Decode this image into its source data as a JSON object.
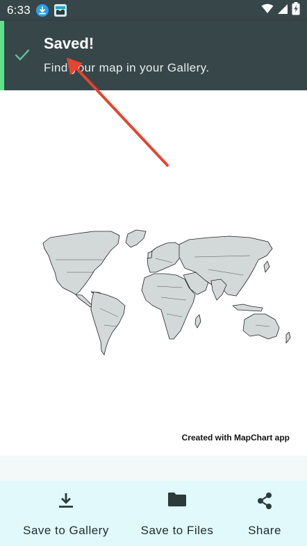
{
  "status_bar": {
    "time": "6:33"
  },
  "toast": {
    "title": "Saved!",
    "message": "Find your map in your Gallery."
  },
  "map": {
    "credit": "Created with MapChart app"
  },
  "actions": [
    {
      "label": "Save to Gallery",
      "icon": "download-icon"
    },
    {
      "label": "Save to Files",
      "icon": "folder-icon"
    },
    {
      "label": "Share",
      "icon": "share-icon"
    }
  ],
  "colors": {
    "toast_bg": "#374649",
    "toast_accent": "#5fe08a",
    "check": "#5fbf9a",
    "land": "#d3d8d8",
    "action_bar": "#e1f9fb",
    "arrow": "#e8432e"
  }
}
